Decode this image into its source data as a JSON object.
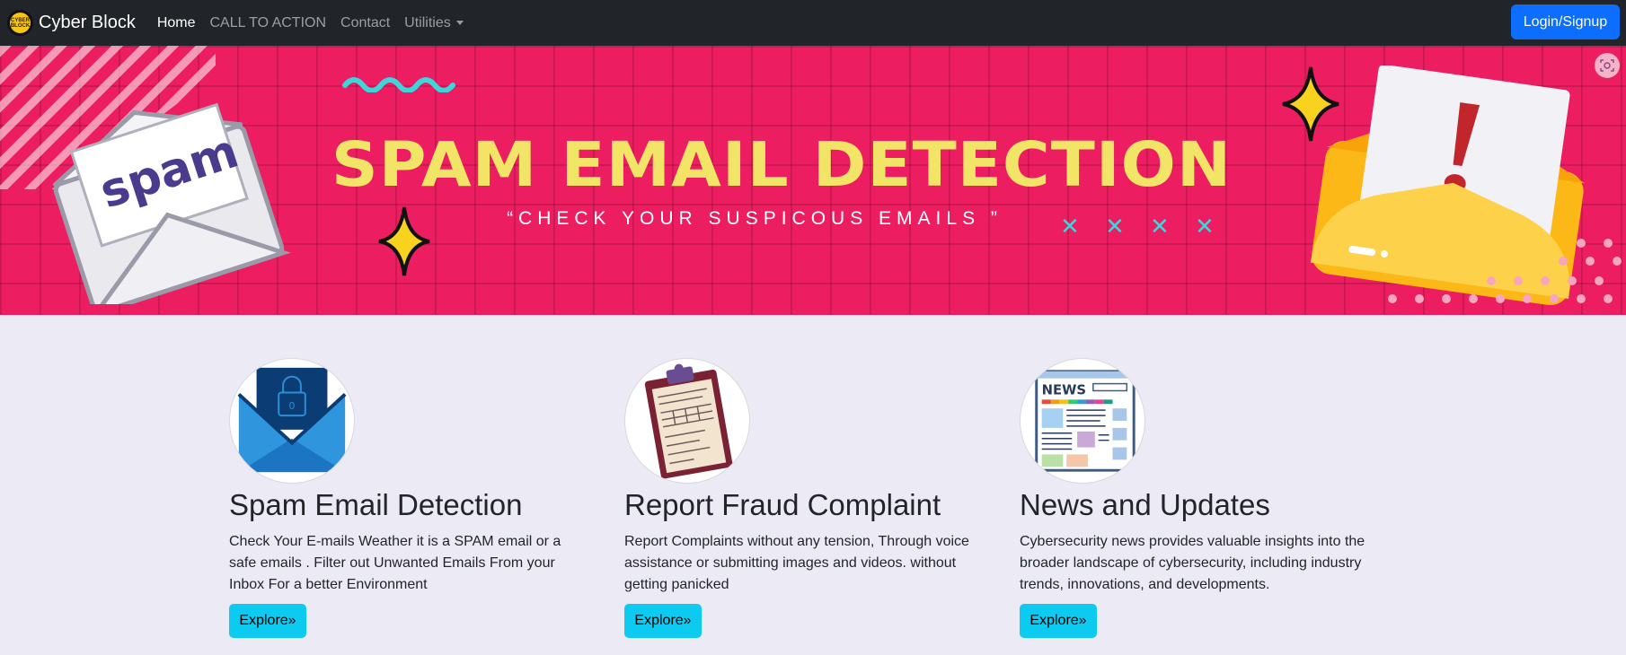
{
  "navbar": {
    "brand": "Cyber Block",
    "brand_logo_text": "CYBER BLOCK",
    "links": [
      "Home",
      "CALL TO ACTION",
      "Contact",
      "Utilities"
    ],
    "login_label": "Login/Signup"
  },
  "banner": {
    "title": "SPAM EMAIL DETECTION",
    "subtitle": "“CHECK YOUR SUSPICOUS EMAILS ”",
    "envelope_word": "spam",
    "x_mark": "✕",
    "colors": {
      "background": "#ec1d60",
      "title": "#f2e467",
      "accent": "#3cd6dc"
    }
  },
  "features": [
    {
      "title": "Spam Email Detection",
      "text": "Check Your E-mails Weather it is a SPAM email or a safe emails . Filter out Unwanted Emails From your Inbox For a better Environment",
      "button": "Explore»",
      "icon": "email-lock-icon"
    },
    {
      "title": "Report Fraud Complaint",
      "text": "Report Complaints without any tension, Through voice assistance or submitting images and videos. without getting panicked",
      "button": "Explore»",
      "icon": "clipboard-icon"
    },
    {
      "title": "News and Updates",
      "text": "Cybersecurity news provides valuable insights into the broader landscape of cybersecurity, including industry trends, innovations, and developments.",
      "button": "Explore»",
      "icon": "newspaper-icon",
      "icon_text": "NEWS"
    }
  ]
}
